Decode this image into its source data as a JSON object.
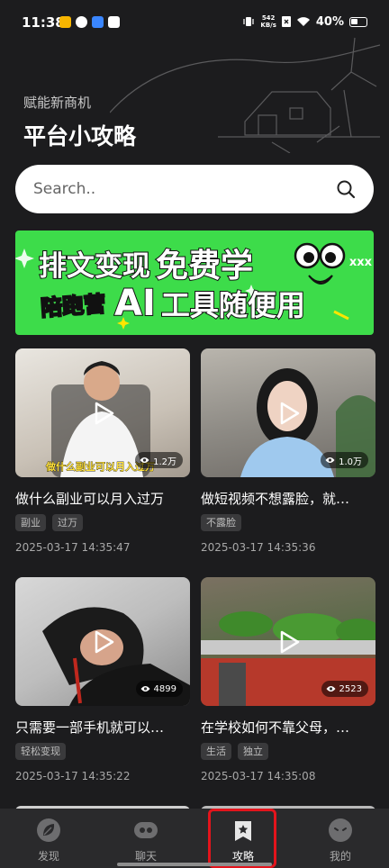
{
  "status_bar": {
    "time": "11:38",
    "net_speed_value": "542",
    "net_speed_unit": "KB/s",
    "battery": "40%"
  },
  "header": {
    "subtitle": "赋能新商机",
    "title": "平台小攻略"
  },
  "search": {
    "placeholder": "Search.."
  },
  "banner": {
    "line1": [
      "排文变现",
      "免费学"
    ],
    "line2_tag": "陪跑营",
    "line2": [
      "AI",
      "工具随便用"
    ],
    "x_marks": "xxx"
  },
  "cards": [
    {
      "title": "做什么副业可以月入过万",
      "views": "1.2万",
      "caption": "做什么副业可以月入过万",
      "tags": [
        "副业",
        "过万"
      ],
      "date": "2025-03-17 14:35:47"
    },
    {
      "title": "做短视频不想露脸，就…",
      "views": "1.0万",
      "caption": "",
      "tags": [
        "不露脸"
      ],
      "date": "2025-03-17 14:35:36"
    },
    {
      "title": "只需要一部手机就可以…",
      "views": "4899",
      "caption": "",
      "tags": [
        "轻松变现"
      ],
      "date": "2025-03-17 14:35:22"
    },
    {
      "title": "在学校如何不靠父母，…",
      "views": "2523",
      "caption": "",
      "tags": [
        "生活",
        "独立"
      ],
      "date": "2025-03-17 14:35:08"
    }
  ],
  "tabs": [
    {
      "label": "发现",
      "icon": "leaf-icon"
    },
    {
      "label": "聊天",
      "icon": "chat-bubble-icon"
    },
    {
      "label": "攻略",
      "icon": "guide-book-icon",
      "active": true
    },
    {
      "label": "我的",
      "icon": "profile-face-icon"
    }
  ],
  "colors": {
    "background": "#1c1c1e",
    "banner_green": "#3ddc4a",
    "highlight_red": "#e3141c",
    "tabbar": "#2a2a2c"
  }
}
